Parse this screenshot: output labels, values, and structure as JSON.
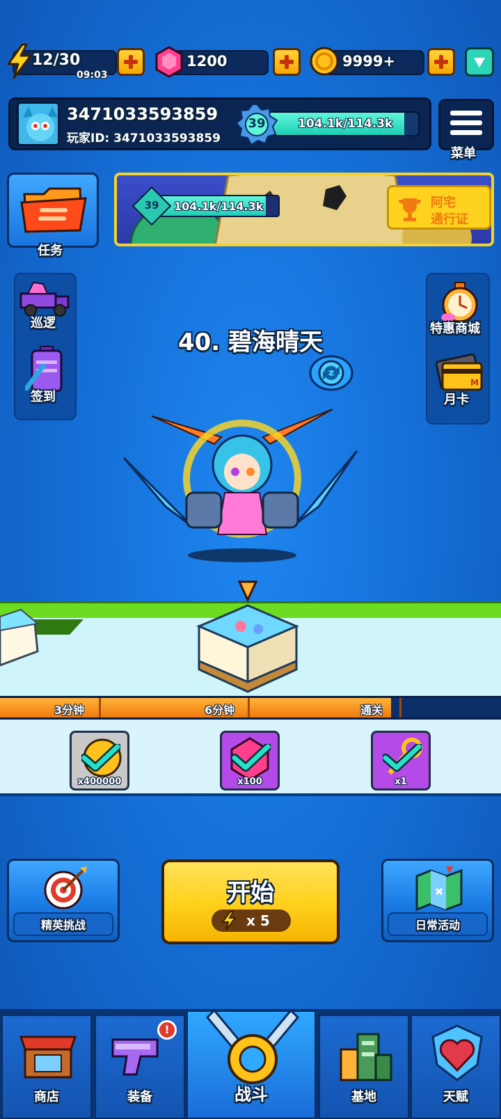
{
  "resources": {
    "energy": "12/30",
    "energy_timer": "09:03",
    "gems": "1200",
    "coins": "9999+"
  },
  "player": {
    "name": "3471033593859",
    "id_label": "玩家ID: 3471033593859",
    "level": "39",
    "xp": "104.1k/114.3k",
    "xp_fraction": 0.91
  },
  "menu_label": "菜单",
  "left_tasks_label": "任务",
  "banner": {
    "level": "39",
    "xp": "104.1k/114.3k",
    "pass_label_1": "阿宅",
    "pass_label_2": "通行证"
  },
  "left_side": {
    "patrol": "巡逻",
    "checkin": "签到"
  },
  "right_side": {
    "shop": "特惠商城",
    "monthly_card": "月卡"
  },
  "stage_title": "40. 碧海晴天",
  "milestones": {
    "items": [
      "3分钟",
      "6分钟",
      "通关"
    ],
    "progress_fraction": 0.78
  },
  "rewards": [
    {
      "qty": "x400000",
      "icon": "coin-icon"
    },
    {
      "qty": "x100",
      "icon": "gem-icon"
    },
    {
      "qty": "x1",
      "icon": "key-icon"
    }
  ],
  "elite_challenge": "精英挑战",
  "start": {
    "label": "开始",
    "cost": "x 5"
  },
  "daily_event": "日常活动",
  "nav": {
    "shop": "商店",
    "equipment": "装备",
    "battle": "战斗",
    "base": "基地",
    "talent": "天赋"
  },
  "colors": {
    "accent_yellow": "#ffd21f",
    "xp_teal": "#1ecfb6",
    "bg_blue": "#1570d8"
  }
}
